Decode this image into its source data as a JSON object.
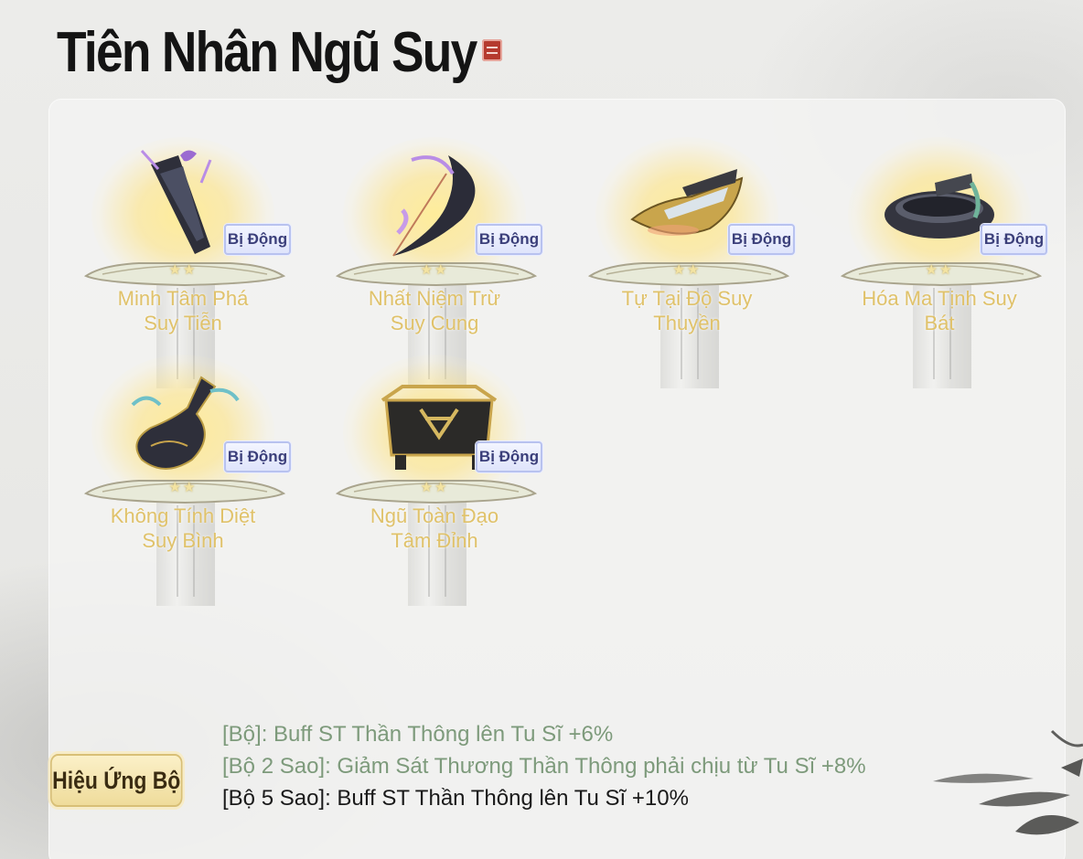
{
  "title": "Tiên Nhân Ngũ Suy",
  "badge_label": "Bị Động",
  "star_glyph": "★★",
  "items": [
    {
      "name_line1": "Minh Tâm Phá",
      "name_line2": "Suy Tiễn",
      "icon": "arrow-quiver-icon"
    },
    {
      "name_line1": "Nhất Niệm Trừ",
      "name_line2": "Suy Cung",
      "icon": "bow-icon"
    },
    {
      "name_line1": "Tự Tại Độ Suy",
      "name_line2": "Thuyền",
      "icon": "boat-icon"
    },
    {
      "name_line1": "Hóa Ma Tịnh Suy",
      "name_line2": "Bát",
      "icon": "bowl-icon"
    },
    {
      "name_line1": "Không Tính Diệt",
      "name_line2": "Suy Bình",
      "icon": "vase-icon"
    },
    {
      "name_line1": "Ngũ Toàn Đạo",
      "name_line2": "Tâm Đỉnh",
      "icon": "cauldron-icon"
    }
  ],
  "set_effect": {
    "label": "Hiệu Ứng Bộ",
    "lines": [
      "[Bộ]: Buff ST Thần Thông lên Tu Sĩ +6%",
      "[Bộ 2 Sao]: Giảm Sát Thương Thần Thông phải chịu từ Tu Sĩ +8%",
      "[Bộ 5 Sao]: Buff ST Thần Thông lên Tu Sĩ +10%"
    ]
  },
  "colors": {
    "item_name": "#e0c26a",
    "effect_inactive": "#7d9a7b",
    "effect_active": "#1a1a1a",
    "badge_text": "#3b3f7a"
  }
}
